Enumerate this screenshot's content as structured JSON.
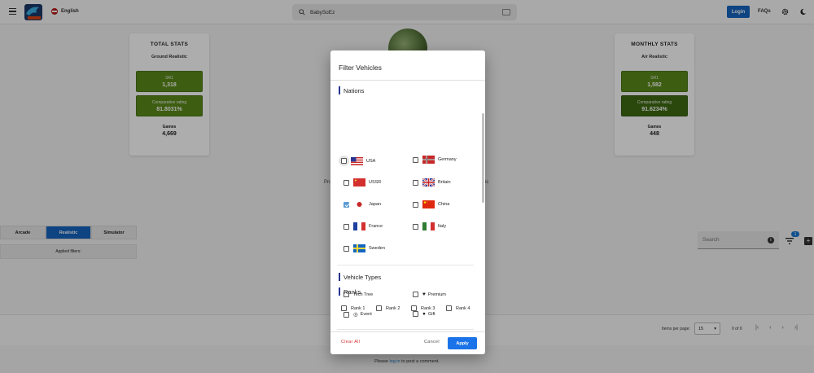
{
  "header": {
    "language": "English",
    "search_value": "BabySoEz",
    "login_label": "Login",
    "faqs_label": "FAQs"
  },
  "total_stats": {
    "title": "TOTAL STATS",
    "mode": "Ground Realistic",
    "sr_label": "SR1",
    "sr_value": "1,318",
    "rating_label": "Comparative rating",
    "rating_value": "81.8031%",
    "games_label": "Games",
    "games_value": "4,669"
  },
  "monthly_stats": {
    "title": "MONTHLY STATS",
    "mode": "Air Realistic",
    "sr_label": "SR1",
    "sr_value": "1,582",
    "rating_label": "Comparative rating",
    "rating_value": "91.6234%",
    "games_label": "Games",
    "games_value": "448"
  },
  "background": {
    "left_fragment": "Pro",
    "right_fragment": "ic",
    "tabs": [
      "Arcade",
      "Realistic",
      "Simulator"
    ],
    "applied_filters": "Applied filters:",
    "search_placeholder": "Search",
    "filter_badge": "1",
    "items_per_page_label": "Items per page:",
    "items_per_page_value": "15",
    "range_label": "0 of 0",
    "comment_prefix": "Please",
    "comment_link": "log in",
    "comment_suffix": "to post a comment."
  },
  "modal": {
    "title": "Filter Vehicles",
    "nations_heading": "Nations",
    "nations": [
      {
        "name": "USA",
        "checked": false
      },
      {
        "name": "Germany",
        "checked": false
      },
      {
        "name": "USSR",
        "checked": false
      },
      {
        "name": "Britain",
        "checked": false
      },
      {
        "name": "Japan",
        "checked": true
      },
      {
        "name": "China",
        "checked": false
      },
      {
        "name": "France",
        "checked": false
      },
      {
        "name": "Italy",
        "checked": false
      },
      {
        "name": "Sweden",
        "checked": false
      }
    ],
    "types_heading": "Vehicle Types",
    "types": [
      "Tech Tree",
      "Premium",
      "Event",
      "Gift"
    ],
    "ranks_heading": "Ranks",
    "ranks": [
      "Rank 1",
      "Rank 2",
      "Rank 3",
      "Rank 4"
    ],
    "clear_label": "Clear All",
    "cancel_label": "Cancel",
    "apply_label": "Apply"
  },
  "colors": {
    "primary": "#1565c0",
    "stat_green": "#5a8a1a",
    "stat_green_dark": "#3f6a12",
    "clear_red": "#d32f2f",
    "apply_blue": "#1a73e8"
  }
}
